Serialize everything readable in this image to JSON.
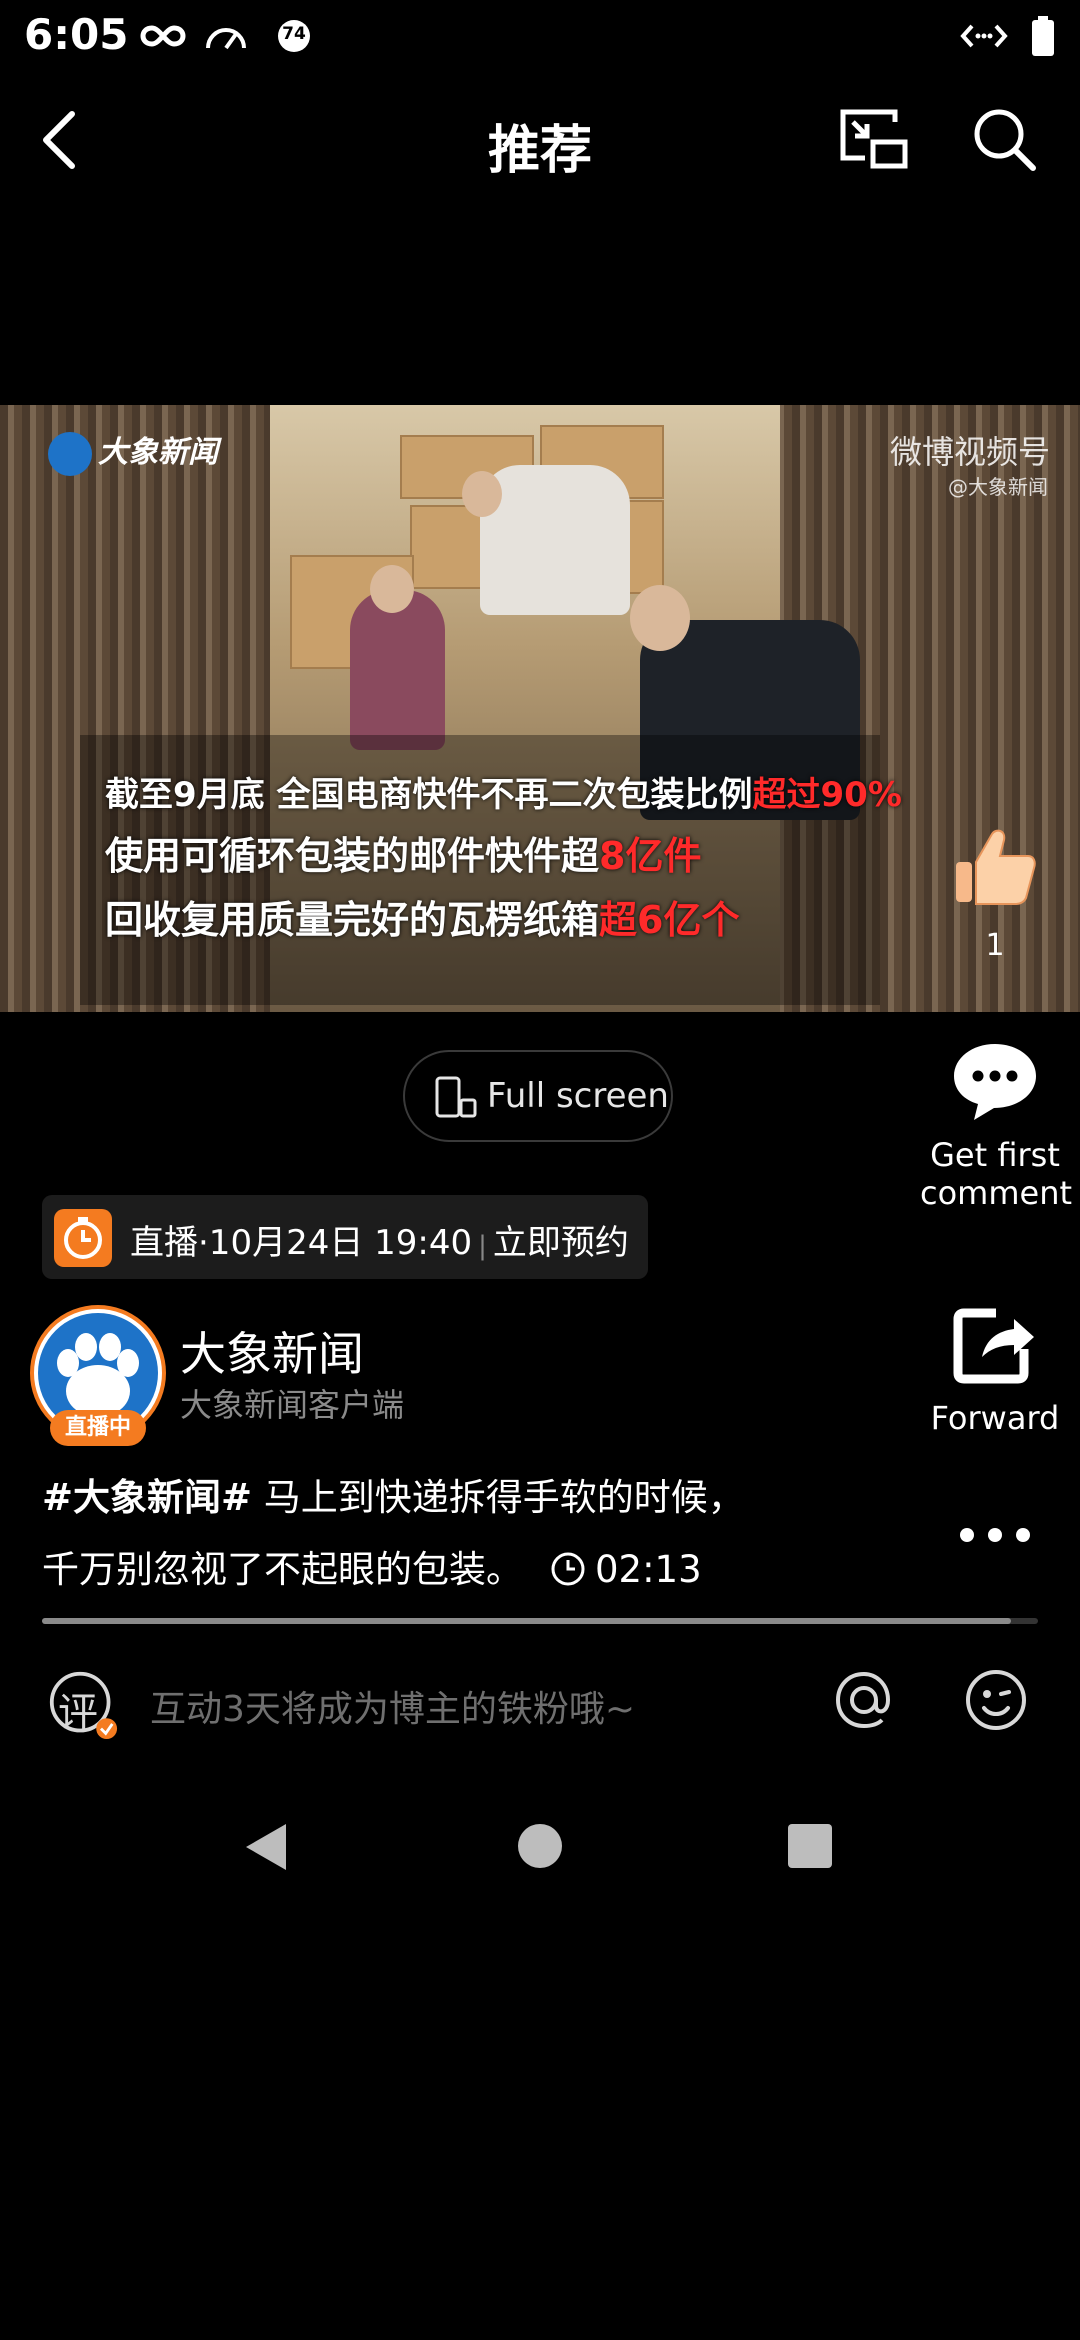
{
  "status_bar": {
    "time": "6:05",
    "right_icons": [
      "code-icon",
      "battery-icon"
    ],
    "left_icons": [
      "infinity-icon",
      "speedometer-icon",
      "notification-74-icon"
    ],
    "notification_badge": "74"
  },
  "top_nav": {
    "title": "推荐"
  },
  "video": {
    "brand": "大象新闻",
    "watermark": "微博视频号",
    "watermark_sub": "@大象新闻",
    "caption_line1_a": "截至9月底 全国电商快件不再二次包装比例",
    "caption_line1_b": "超过90%",
    "caption_line2_a": "使用可循环包装的邮件快件超",
    "caption_line2_b": "8亿件",
    "caption_line3_a": "回收复用质量完好的瓦楞纸箱",
    "caption_line3_b": "超6亿个"
  },
  "like": {
    "count": "1"
  },
  "fullscreen": {
    "label": "Full screen"
  },
  "comment": {
    "label": "Get first comment"
  },
  "forward": {
    "label": "Forward"
  },
  "live": {
    "text_a": "直播·10月24日 19:40",
    "text_b": "立即预约"
  },
  "author": {
    "name": "大象新闻",
    "sub": "大象新闻客户端",
    "live_badge": "直播中"
  },
  "description": {
    "tag": "#大象新闻#",
    "text1": " 马上到快递拆得手软的时候，",
    "text2": "千万别忽视了不起眼的包装。",
    "duration": "02:13"
  },
  "progress": {
    "fraction": 0.973
  },
  "comment_input": {
    "placeholder": "互动3天将成为博主的铁粉哦~",
    "ping_glyph": "评"
  },
  "colors": {
    "accent": "#f47b20",
    "highlight": "#ff2a2a"
  }
}
